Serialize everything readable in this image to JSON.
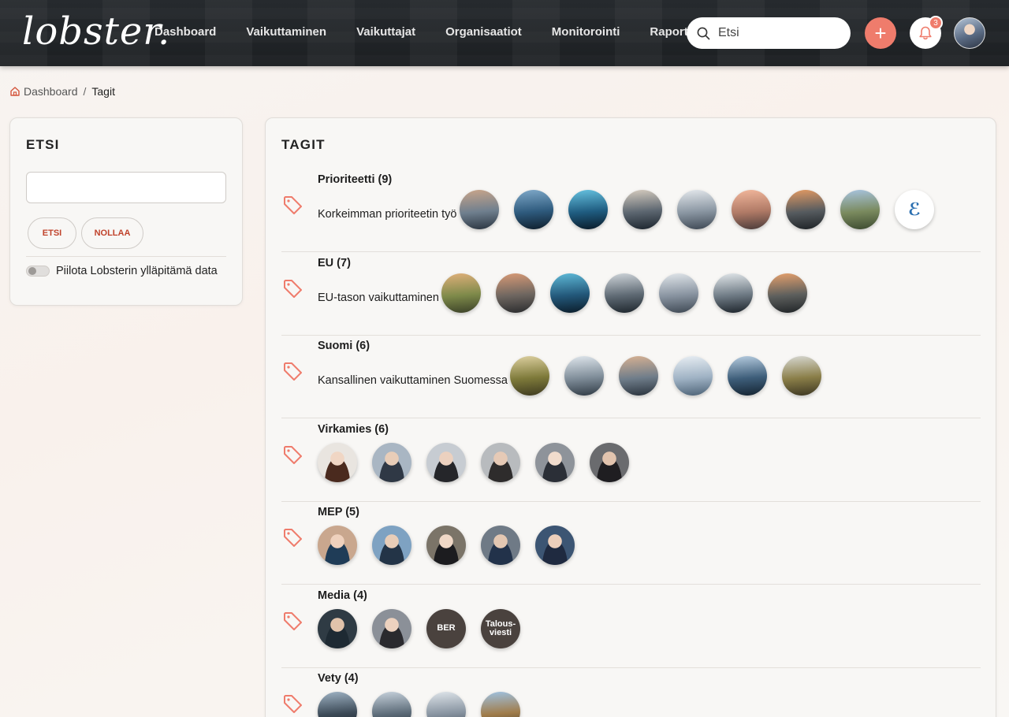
{
  "header": {
    "logo": "lobster.",
    "nav": [
      "Dashboard",
      "Vaikuttaminen",
      "Vaikuttajat",
      "Organisaatiot",
      "Monitorointi",
      "Raportit"
    ],
    "search_placeholder": "Etsi",
    "add_label": "+",
    "notifications_count": "3"
  },
  "breadcrumb": {
    "home": "Dashboard",
    "separator": "/",
    "current": "Tagit"
  },
  "filter": {
    "title": "ETSI",
    "search_value": "",
    "search_button": "ETSI",
    "reset_button": "NOLLAA",
    "toggle_label": "Piilota Lobsterin ylläpitämä data",
    "toggle_on": false
  },
  "tags_panel": {
    "title": "TAGIT",
    "tags": [
      {
        "title": "Prioriteetti (9)",
        "description": "Korkeimman prioriteetin työ",
        "thumbs": [
          {
            "kind": "photo",
            "colors": [
              "#c9a58a",
              "#6f7f8e",
              "#2a3440"
            ]
          },
          {
            "kind": "photo",
            "colors": [
              "#7fa9c9",
              "#2e5a7d",
              "#0f1e2c"
            ]
          },
          {
            "kind": "photo",
            "colors": [
              "#66c2e0",
              "#1f5c80",
              "#0a1a28"
            ]
          },
          {
            "kind": "photo",
            "colors": [
              "#d6ccbf",
              "#5c6670",
              "#1b242d"
            ]
          },
          {
            "kind": "photo",
            "colors": [
              "#e4e8ec",
              "#8a96a2",
              "#3d4753"
            ]
          },
          {
            "kind": "photo",
            "colors": [
              "#f2b79c",
              "#b07a66",
              "#4a3b3a"
            ]
          },
          {
            "kind": "photo",
            "colors": [
              "#e39a63",
              "#565b5f",
              "#1d2226"
            ]
          },
          {
            "kind": "photo",
            "colors": [
              "#a8c4e0",
              "#7a8a5e",
              "#3c4a30"
            ]
          },
          {
            "kind": "logo",
            "label": "ℰ",
            "colors": [
              "#ffffff",
              "#ffffff",
              "#ffffff"
            ]
          }
        ]
      },
      {
        "title": "EU (7)",
        "description": "EU-tason vaikuttaminen",
        "thumbs": [
          {
            "kind": "photo",
            "colors": [
              "#e0b07a",
              "#7e8a4a",
              "#3b4128"
            ]
          },
          {
            "kind": "photo",
            "colors": [
              "#d89a76",
              "#6e6660",
              "#2a2b2d"
            ]
          },
          {
            "kind": "photo",
            "colors": [
              "#5fbad8",
              "#23587a",
              "#0b1c29"
            ]
          },
          {
            "kind": "photo",
            "colors": [
              "#cfd5da",
              "#5f6a74",
              "#1d252c"
            ]
          },
          {
            "kind": "photo",
            "colors": [
              "#e1e6ea",
              "#8893a0",
              "#3e4853"
            ]
          },
          {
            "kind": "photo",
            "colors": [
              "#e2e7ea",
              "#6f7b85",
              "#1c232a"
            ]
          },
          {
            "kind": "photo",
            "colors": [
              "#e6a06c",
              "#5d5f5d",
              "#202427"
            ]
          }
        ]
      },
      {
        "title": "Suomi (6)",
        "description": "Kansallinen vaikuttaminen Suomessa",
        "thumbs": [
          {
            "kind": "photo",
            "colors": [
              "#ddd0a0",
              "#7e7a3a",
              "#3e3a20"
            ]
          },
          {
            "kind": "photo",
            "colors": [
              "#dfe6ec",
              "#7f8d99",
              "#2f3a44"
            ]
          },
          {
            "kind": "photo",
            "colors": [
              "#d7b192",
              "#6f7d8a",
              "#29323c"
            ]
          },
          {
            "kind": "photo",
            "colors": [
              "#e8eef3",
              "#9fb2c4",
              "#4c6276"
            ]
          },
          {
            "kind": "photo",
            "colors": [
              "#b7cde0",
              "#3e5e7a",
              "#142331"
            ]
          },
          {
            "kind": "photo",
            "colors": [
              "#d7d8d2",
              "#8a7e48",
              "#3c3622"
            ]
          }
        ]
      },
      {
        "title": "Virkamies (6)",
        "description": "",
        "thumbs": [
          {
            "kind": "person",
            "colors": [
              "#f0d6c4",
              "#4a2a1e",
              "#e9e5e0"
            ]
          },
          {
            "kind": "person",
            "colors": [
              "#e8cdb8",
              "#2f3845",
              "#a9b6c3"
            ]
          },
          {
            "kind": "person",
            "colors": [
              "#ecd1bf",
              "#25262a",
              "#c7ccd2"
            ]
          },
          {
            "kind": "person",
            "colors": [
              "#e6cab6",
              "#2e2c2c",
              "#b8bbbe"
            ]
          },
          {
            "kind": "person",
            "colors": [
              "#f1dccd",
              "#2b2f37",
              "#8e939a"
            ]
          },
          {
            "kind": "person",
            "colors": [
              "#e2c4ae",
              "#1f1e21",
              "#6a6b6e"
            ]
          }
        ]
      },
      {
        "title": "MEP (5)",
        "description": "",
        "thumbs": [
          {
            "kind": "person",
            "colors": [
              "#efd1bd",
              "#1f3c57",
              "#c9a78e"
            ]
          },
          {
            "kind": "person",
            "colors": [
              "#e8cdb8",
              "#233447",
              "#7ea2c2"
            ]
          },
          {
            "kind": "person",
            "colors": [
              "#f0d8c6",
              "#1c1c1f",
              "#7b7468"
            ]
          },
          {
            "kind": "person",
            "colors": [
              "#e3c7b2",
              "#22324a",
              "#6f7a86"
            ]
          },
          {
            "kind": "person",
            "colors": [
              "#eccfbb",
              "#1f2a40",
              "#3c5573"
            ]
          }
        ]
      },
      {
        "title": "Media (4)",
        "description": "",
        "thumbs": [
          {
            "kind": "person",
            "colors": [
              "#e1c3ab",
              "#1e2a33",
              "#2f3b44"
            ]
          },
          {
            "kind": "person",
            "colors": [
              "#edd2bf",
              "#2a2a2e",
              "#8b9098"
            ]
          },
          {
            "kind": "text",
            "label": "BER",
            "colors": [
              "#4a423e",
              "#4a423e",
              "#4a423e"
            ]
          },
          {
            "kind": "text",
            "label": "Talous-\nviesti",
            "colors": [
              "#4a423e",
              "#4a423e",
              "#4a423e"
            ]
          }
        ]
      },
      {
        "title": "Vety (4)",
        "description": "",
        "thumbs": [
          {
            "kind": "photo",
            "colors": [
              "#9fb3c4",
              "#3c4a57",
              "#141b22"
            ]
          },
          {
            "kind": "photo",
            "colors": [
              "#c7d2dc",
              "#5d6c79",
              "#1e2731"
            ]
          },
          {
            "kind": "photo",
            "colors": [
              "#dfe5ea",
              "#8793a0",
              "#3d4752"
            ]
          },
          {
            "kind": "photo",
            "colors": [
              "#9fc2e2",
              "#a07c4a",
              "#3a3526"
            ]
          }
        ]
      }
    ]
  },
  "colors": {
    "accent": "#ef7c6c",
    "accent_text": "#c0432c",
    "header_bg": "#1f2326",
    "card_bg": "#f8f7f5"
  }
}
